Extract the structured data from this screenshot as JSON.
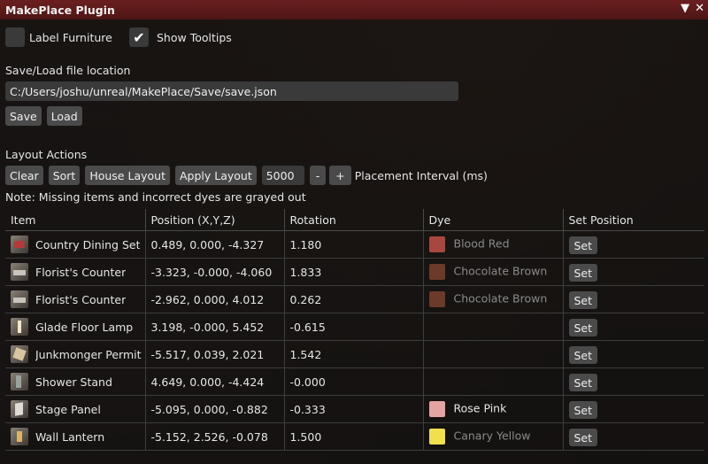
{
  "window": {
    "title": "MakePlace Plugin",
    "collapse_icon": "triangle-down-icon",
    "close_icon": "close-icon"
  },
  "options": {
    "label_furniture": {
      "label": "Label Furniture",
      "checked": false
    },
    "show_tooltips": {
      "label": "Show Tooltips",
      "checked": true
    }
  },
  "saveload": {
    "heading": "Save/Load file location",
    "path": "C:/Users/joshu/unreal/MakePlace/Save/save.json",
    "save_label": "Save",
    "load_label": "Load"
  },
  "layout_actions": {
    "heading": "Layout Actions",
    "clear_label": "Clear",
    "sort_label": "Sort",
    "house_layout_label": "House Layout",
    "apply_layout_label": "Apply Layout",
    "interval_value": "5000",
    "minus_label": "-",
    "plus_label": "+",
    "interval_label": "Placement Interval (ms)"
  },
  "note": "Note: Missing items and incorrect dyes are grayed out",
  "table": {
    "headers": [
      "Item",
      "Position (X,Y,Z)",
      "Rotation",
      "Dye",
      "Set Position"
    ],
    "rows": [
      {
        "icon": "chair-icon",
        "item": "Country Dining Set",
        "position": "0.489, 0.000, -4.327",
        "rotation": "1.180",
        "dye": "Blood Red",
        "dye_color": "#a8473f",
        "dye_grayed": true,
        "set_label": "Set"
      },
      {
        "icon": "counter-icon",
        "item": "Florist's Counter",
        "position": "-3.323, -0.000, -4.060",
        "rotation": "1.833",
        "dye": "Chocolate Brown",
        "dye_color": "#6b3a2a",
        "dye_grayed": true,
        "set_label": "Set"
      },
      {
        "icon": "counter-icon",
        "item": "Florist's Counter",
        "position": "-2.962, 0.000, 4.012",
        "rotation": "0.262",
        "dye": "Chocolate Brown",
        "dye_color": "#6b3a2a",
        "dye_grayed": true,
        "set_label": "Set"
      },
      {
        "icon": "lamp-icon",
        "item": "Glade Floor Lamp",
        "position": "3.198, -0.000, 5.452",
        "rotation": "-0.615",
        "dye": "",
        "dye_color": "",
        "dye_grayed": false,
        "set_label": "Set"
      },
      {
        "icon": "permit-icon",
        "item": "Junkmonger Permit A",
        "position": "-5.517, 0.039, 2.021",
        "rotation": "1.542",
        "dye": "",
        "dye_color": "",
        "dye_grayed": false,
        "set_label": "Set"
      },
      {
        "icon": "shower-icon",
        "item": "Shower Stand",
        "position": "4.649, 0.000, -4.424",
        "rotation": "-0.000",
        "dye": "",
        "dye_color": "",
        "dye_grayed": false,
        "set_label": "Set"
      },
      {
        "icon": "panel-icon",
        "item": "Stage Panel",
        "position": "-5.095, 0.000, -0.882",
        "rotation": "-0.333",
        "dye": "Rose Pink",
        "dye_color": "#e3a3a0",
        "dye_grayed": false,
        "set_label": "Set"
      },
      {
        "icon": "lantern-icon",
        "item": "Wall Lantern",
        "position": "-5.152, 2.526, -0.078",
        "rotation": "1.500",
        "dye": "Canary Yellow",
        "dye_color": "#f0e050",
        "dye_grayed": true,
        "set_label": "Set"
      }
    ]
  }
}
